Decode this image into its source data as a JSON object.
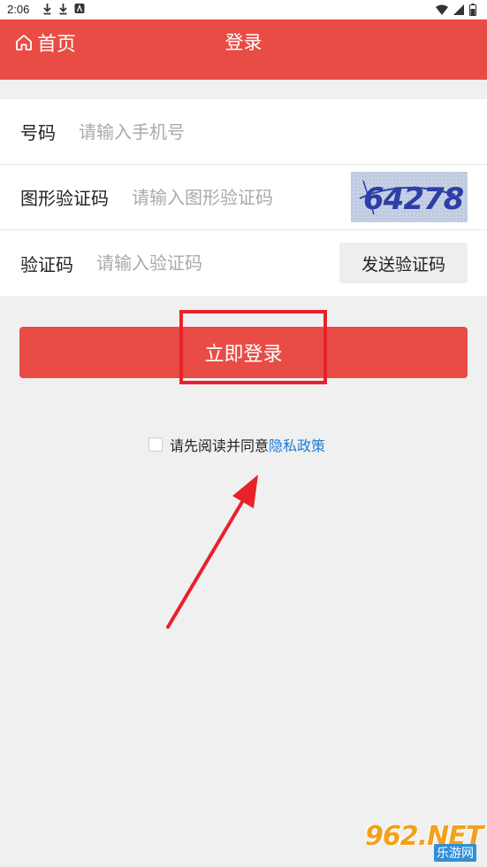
{
  "status_bar": {
    "time": "2:06",
    "icons_left": [
      "download-icon",
      "download-icon",
      "app-icon"
    ],
    "icons_right": [
      "wifi-icon",
      "signal-icon",
      "battery-icon"
    ]
  },
  "header": {
    "home_label": "首页",
    "title": "登录",
    "color": "#e84c45"
  },
  "form": {
    "phone": {
      "label": "号码",
      "placeholder": "请输入手机号",
      "value": ""
    },
    "captcha": {
      "label": "图形验证码",
      "placeholder": "请输入图形验证码",
      "value": "",
      "image_text": "64278"
    },
    "code": {
      "label": "验证码",
      "placeholder": "请输入验证码",
      "value": "",
      "send_label": "发送验证码"
    }
  },
  "login_button": {
    "label": "立即登录",
    "color": "#e84c45"
  },
  "agreement": {
    "checked": false,
    "text": "请先阅读并同意",
    "link": "隐私政策",
    "link_color": "#1c7cd6"
  },
  "annotation": {
    "color": "#e8222b"
  },
  "watermark": {
    "brand": "962.NET",
    "sub": "乐游网"
  }
}
